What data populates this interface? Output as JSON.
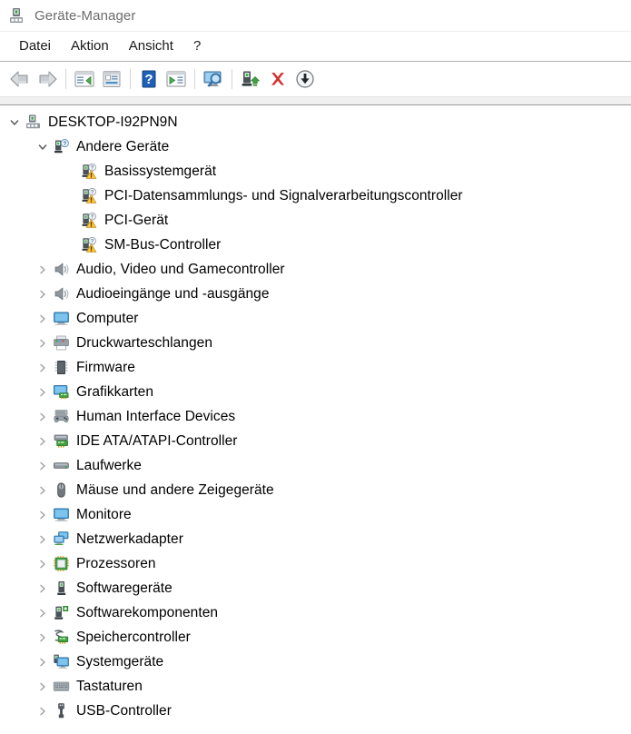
{
  "window": {
    "title": "Geräte-Manager",
    "icon": "device-manager-icon"
  },
  "menu": {
    "items": [
      {
        "label": "Datei",
        "name": "menu-datei"
      },
      {
        "label": "Aktion",
        "name": "menu-aktion"
      },
      {
        "label": "Ansicht",
        "name": "menu-ansicht"
      },
      {
        "label": "?",
        "name": "menu-help"
      }
    ]
  },
  "toolbar": {
    "buttons": [
      {
        "icon": "back-arrow-icon",
        "name": "toolbar-back"
      },
      {
        "icon": "forward-arrow-icon",
        "name": "toolbar-forward"
      },
      {
        "separator": true
      },
      {
        "icon": "show-hide-console-tree-icon",
        "name": "toolbar-show-console-tree"
      },
      {
        "icon": "properties-icon",
        "name": "toolbar-properties"
      },
      {
        "separator": true
      },
      {
        "icon": "help-icon",
        "name": "toolbar-help"
      },
      {
        "icon": "update-driver-icon",
        "name": "toolbar-update-driver"
      },
      {
        "separator": true
      },
      {
        "icon": "scan-for-hardware-changes-icon",
        "name": "toolbar-scan-hardware-changes"
      },
      {
        "separator": true
      },
      {
        "icon": "enable-device-icon",
        "name": "toolbar-enable-device"
      },
      {
        "icon": "uninstall-device-icon",
        "name": "toolbar-uninstall-device"
      },
      {
        "icon": "disable-device-icon",
        "name": "toolbar-disable-device"
      }
    ]
  },
  "tree": {
    "root": {
      "label": "DESKTOP-I92PN9N",
      "icon": "computer-root-icon",
      "expanded": true
    },
    "other_devices": {
      "label": "Andere Geräte",
      "icon": "unknown-device-icon",
      "expanded": true,
      "children": [
        {
          "label": "Basissystemgerät",
          "icon": "unknown-device-warning-icon"
        },
        {
          "label": "PCI-Datensammlungs- und Signalverarbeitungscontroller",
          "icon": "unknown-device-warning-icon"
        },
        {
          "label": "PCI-Gerät",
          "icon": "unknown-device-warning-icon"
        },
        {
          "label": "SM-Bus-Controller",
          "icon": "unknown-device-warning-icon"
        }
      ]
    },
    "categories": [
      {
        "label": "Audio, Video und Gamecontroller",
        "icon": "speaker-icon"
      },
      {
        "label": "Audioeingänge und -ausgänge",
        "icon": "speaker-icon"
      },
      {
        "label": "Computer",
        "icon": "monitor-icon"
      },
      {
        "label": "Druckwarteschlangen",
        "icon": "printer-icon"
      },
      {
        "label": "Firmware",
        "icon": "firmware-chip-icon"
      },
      {
        "label": "Grafikkarten",
        "icon": "display-adapter-icon"
      },
      {
        "label": "Human Interface Devices",
        "icon": "hid-gamepad-icon"
      },
      {
        "label": "IDE ATA/ATAPI-Controller",
        "icon": "ide-controller-icon"
      },
      {
        "label": "Laufwerke",
        "icon": "disk-drive-icon"
      },
      {
        "label": "Mäuse und andere Zeigegeräte",
        "icon": "mouse-icon"
      },
      {
        "label": "Monitore",
        "icon": "monitor-icon"
      },
      {
        "label": "Netzwerkadapter",
        "icon": "network-adapter-icon"
      },
      {
        "label": "Prozessoren",
        "icon": "processor-icon"
      },
      {
        "label": "Softwaregeräte",
        "icon": "software-device-icon"
      },
      {
        "label": "Softwarekomponenten",
        "icon": "software-component-icon"
      },
      {
        "label": "Speichercontroller",
        "icon": "storage-controller-icon"
      },
      {
        "label": "Systemgeräte",
        "icon": "system-device-icon"
      },
      {
        "label": "Tastaturen",
        "icon": "keyboard-icon"
      },
      {
        "label": "USB-Controller",
        "icon": "usb-icon"
      }
    ]
  },
  "colors": {
    "title_text": "#6b6b6b",
    "menu_text": "#1a1a1a",
    "tree_text": "#000000",
    "chevron": "#a0a0a0",
    "warning_yellow": "#ffc83d",
    "uninstall_red": "#d82f2f",
    "accent_green": "#3fa13f",
    "window_bg": "#ffffff",
    "strip_bg": "#f0f0f0"
  }
}
